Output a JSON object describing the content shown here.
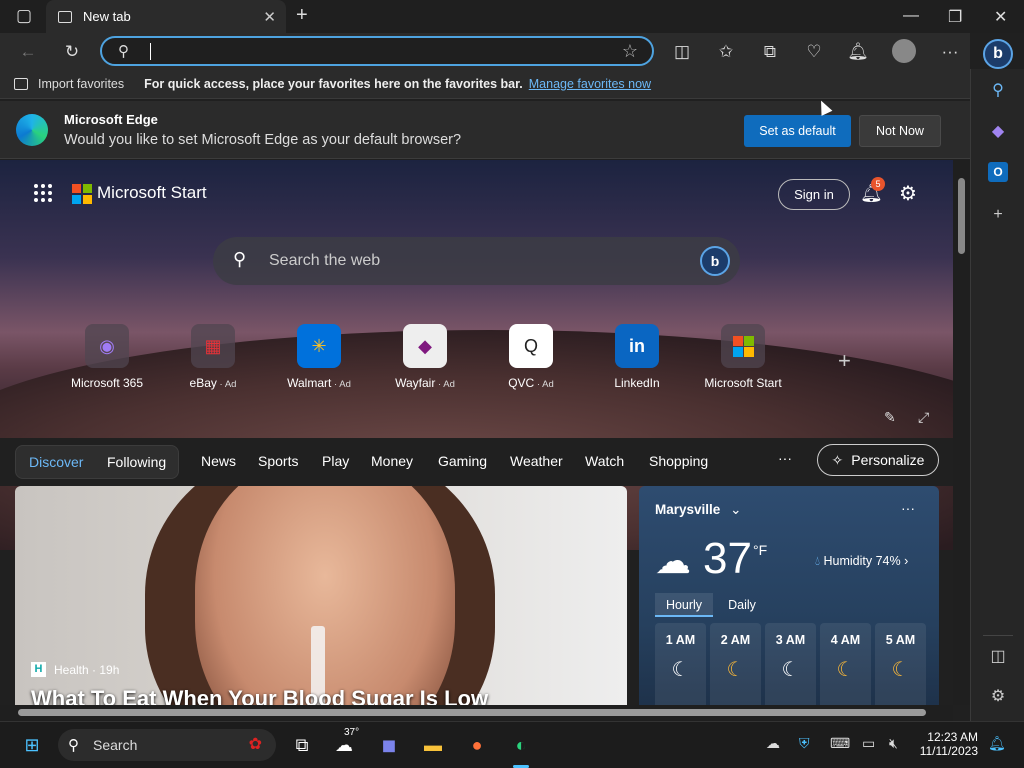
{
  "window": {
    "tab_title": "New tab",
    "minimize": "—",
    "restore": "❐",
    "close": "✕"
  },
  "toolbar": {
    "address_value": ""
  },
  "favorites": {
    "import_label": "Import favorites",
    "message": "For quick access, place your favorites here on the favorites bar.",
    "manage_link": "Manage favorites now"
  },
  "infobar": {
    "title": "Microsoft Edge",
    "question": "Would you like to set Microsoft Edge as your default browser?",
    "primary": "Set as default",
    "secondary": "Not Now"
  },
  "header": {
    "brand": "Microsoft Start",
    "signin": "Sign in",
    "notifications": "5"
  },
  "search": {
    "placeholder": "Search the web",
    "bing": "b"
  },
  "tiles": [
    {
      "label": "Microsoft 365",
      "ad": ""
    },
    {
      "label": "eBay",
      "ad": " · Ad"
    },
    {
      "label": "Walmart",
      "ad": " · Ad"
    },
    {
      "label": "Wayfair",
      "ad": " · Ad"
    },
    {
      "label": "QVC",
      "ad": " · Ad"
    },
    {
      "label": "LinkedIn",
      "ad": ""
    },
    {
      "label": "Microsoft Start",
      "ad": ""
    }
  ],
  "nav": {
    "discover": "Discover",
    "following": "Following",
    "items": [
      "News",
      "Sports",
      "Play",
      "Money",
      "Gaming",
      "Weather",
      "Watch",
      "Shopping"
    ],
    "more": "···",
    "personalize": "Personalize"
  },
  "article": {
    "category": "Health · 19h",
    "category_badge": "H",
    "headline": "What To Eat When Your Blood Sugar Is Low"
  },
  "weather": {
    "city": "Marysville",
    "temp": "37",
    "unit": "°F",
    "humidity": "Humidity 74%",
    "tabs": [
      "Hourly",
      "Daily"
    ],
    "hours": [
      "1 AM",
      "2 AM",
      "3 AM",
      "4 AM",
      "5 AM"
    ]
  },
  "taskbar": {
    "search": "Search",
    "weather_temp": "37°",
    "time": "12:23 AM",
    "date": "11/11/2023"
  }
}
